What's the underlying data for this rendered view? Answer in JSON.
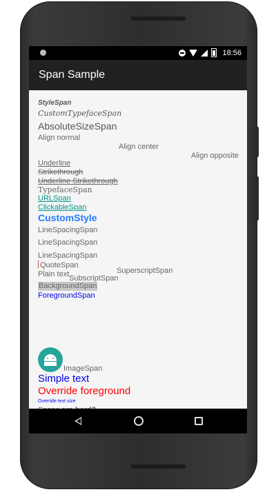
{
  "status": {
    "time": "18:56"
  },
  "app": {
    "title": "Span Sample"
  },
  "lines": {
    "style_span": "StyleSpan",
    "custom_typeface": "CustomTypefaceSpan",
    "absolute_size": "AbsoluteSizeSpan",
    "align_normal": "Align normal",
    "align_center": "Align center",
    "align_opposite": "Align opposite",
    "underline": "Underline",
    "strikethrough": "Strikethrough",
    "underline_strikethrough": "Underline Strikethrough",
    "typeface_span": "TypefaceSpan",
    "url_span": "URLSpan",
    "clickable_span": "ClickableSpan",
    "custom_style": "CustomStyle",
    "line_spacing_1": "LineSpacingSpan",
    "line_spacing_2": "LineSpacingSpan",
    "line_spacing_3": "LineSpacingSpan",
    "quote_span": "QuoteSpan",
    "superscript_span": "SuperscriptSpan",
    "plain_text": "Plain text",
    "subscript_span": "SubscriptSpan",
    "background_span": "BackgroundSpan",
    "foreground_span": "ForegroundSpan",
    "image_span": "ImageSpan",
    "simple_text": "Simple text",
    "override_foreground": "Override foreground",
    "override_text_size": "Override text size",
    "spans_prefix": "Spans ",
    "spans_bold": "are hard?"
  },
  "colors": {
    "link": "#009688",
    "custom_style": "#2979ff",
    "foreground_span": "#0000ee",
    "simple_text": "#0000ee",
    "override_foreground": "#ff0000",
    "override_text_size": "#0000ee",
    "background_highlight": "#c8c8c8",
    "quote_bar": "#e53935",
    "image_icon_bg": "#26a69a"
  },
  "icons": {
    "status_left": "notification-dot-icon",
    "dnd": "do-not-disturb-icon",
    "wifi": "wifi-icon",
    "signal": "signal-icon",
    "battery": "battery-icon",
    "image_span": "android-robot-icon",
    "nav_back": "back-triangle-icon",
    "nav_home": "home-circle-icon",
    "nav_recent": "recent-apps-square-icon"
  }
}
